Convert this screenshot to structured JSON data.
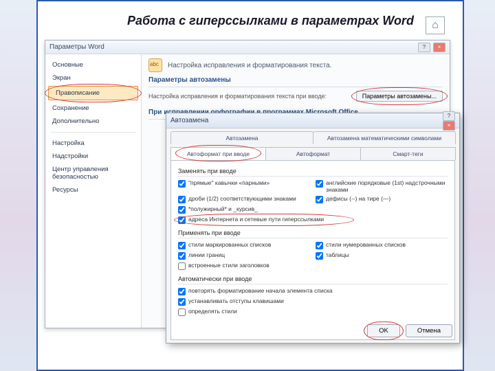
{
  "page_title": "Работа с гиперссылками в параметрах Word",
  "params_window": {
    "title": "Параметры Word",
    "sidebar": [
      {
        "label": "Основные"
      },
      {
        "label": "Экран"
      },
      {
        "label": "Правописание",
        "selected": true
      },
      {
        "label": "Сохранение"
      },
      {
        "label": "Дополнительно"
      },
      {
        "label": "Настройка"
      },
      {
        "label": "Надстройки"
      },
      {
        "label": "Центр управления безопасностью"
      },
      {
        "label": "Ресурсы"
      }
    ],
    "main_header": "Настройка исправления и форматирования текста.",
    "section1_title": "Параметры автозамены",
    "section1_text": "Настройка исправления и форматирования текста при вводе:",
    "ac_button": "Параметры автозамены...",
    "section2_title": "При исправлении орфографии в программах Microsoft Office"
  },
  "dialog2": {
    "title": "Автозамена",
    "tabs_row1": [
      "Автозамена",
      "Автозамена математическими символами"
    ],
    "tabs_row2": [
      "Автоформат при вводе",
      "Автоформат",
      "Смарт-теги"
    ],
    "panel": {
      "group1": "Заменять при вводе",
      "checks1": [
        {
          "label": "\"прямые\" кавычки «парными»",
          "col": 1,
          "checked": true
        },
        {
          "label": "английские порядковые (1st) надстрочными знаками",
          "col": 2,
          "checked": true
        },
        {
          "label": "дроби (1/2) соответствующими знаками",
          "col": 1,
          "checked": true
        },
        {
          "label": "дефисы (--) на тире (—)",
          "col": 2,
          "checked": true
        },
        {
          "label": "*полужирный* и _курсив_",
          "col": 1,
          "checked": true
        },
        {
          "label": "адреса Интернета и сетевые пути гиперссылками",
          "full": true,
          "checked": true,
          "circled": true
        }
      ],
      "group2": "Применять при вводе",
      "checks2": [
        {
          "label": "стили маркированных списков",
          "col": 1,
          "checked": true
        },
        {
          "label": "стили нумерованных списков",
          "col": 2,
          "checked": true
        },
        {
          "label": "линии границ",
          "col": 1,
          "checked": true
        },
        {
          "label": "таблицы",
          "col": 2,
          "checked": true
        },
        {
          "label": "встроенные стили заголовков",
          "col": 1,
          "checked": false
        }
      ],
      "group3": "Автоматически при вводе",
      "checks3": [
        {
          "label": "повторять форматирование начала элемента списка",
          "col": 1,
          "checked": true
        },
        {
          "label": "устанавливать отступы клавишами",
          "col": 1,
          "checked": true
        },
        {
          "label": "определять стили",
          "col": 1,
          "checked": false
        }
      ]
    },
    "ok": "OK",
    "cancel": "Отмена"
  }
}
